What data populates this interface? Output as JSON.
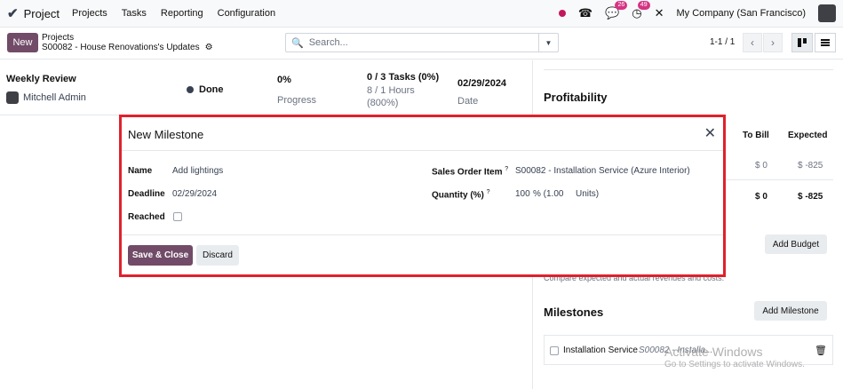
{
  "topnav": {
    "app_name": "Project",
    "menu": [
      "Projects",
      "Tasks",
      "Reporting",
      "Configuration"
    ],
    "chat_badge": "26",
    "activity_badge": "49",
    "company": "My Company (San Francisco)"
  },
  "control": {
    "new_label": "New",
    "breadcrumb_parent": "Projects",
    "breadcrumb_current": "S00082 - House Renovations's Updates",
    "search_placeholder": "Search...",
    "pager": "1-1 / 1"
  },
  "update": {
    "title": "Weekly Review",
    "author": "Mitchell Admin",
    "status": "Done",
    "progress_value": "0%",
    "progress_label": "Progress",
    "tasks_line": "0 / 3 Tasks (0%)",
    "hours_line": "8 / 1 Hours",
    "hours_pct": "(800%)",
    "date_value": "02/29/2024",
    "date_label": "Date"
  },
  "right_panel": {
    "profitability_title": "Profitability",
    "col_to_bill": "To Bill",
    "col_expected": "Expected",
    "row1_to_bill": "$ 0",
    "row1_expected": "$ -825",
    "row2_to_bill": "$ 0",
    "row2_expected": "$ -825",
    "add_budget": "Add Budget",
    "compare_text": "Compare expected and actual revenues and costs.",
    "milestones_title": "Milestones",
    "add_milestone": "Add Milestone",
    "milestone_name": "Installation Service",
    "milestone_ref": "S00082 - Installa..."
  },
  "modal": {
    "title": "New Milestone",
    "name_label": "Name",
    "name_value": "Add lightings",
    "deadline_label": "Deadline",
    "deadline_value": "02/29/2024",
    "reached_label": "Reached",
    "soi_label": "Sales Order Item",
    "soi_value": "S00082 - Installation Service (Azure Interior)",
    "qty_label": "Quantity (%)",
    "qty_value": "100",
    "qty_suffix": "% (1.00",
    "qty_unit": "Units)",
    "help_mark": "?",
    "save_label": "Save & Close",
    "discard_label": "Discard"
  },
  "watermark": {
    "line1": "Activate Windows",
    "line2": "Go to Settings to activate Windows."
  }
}
